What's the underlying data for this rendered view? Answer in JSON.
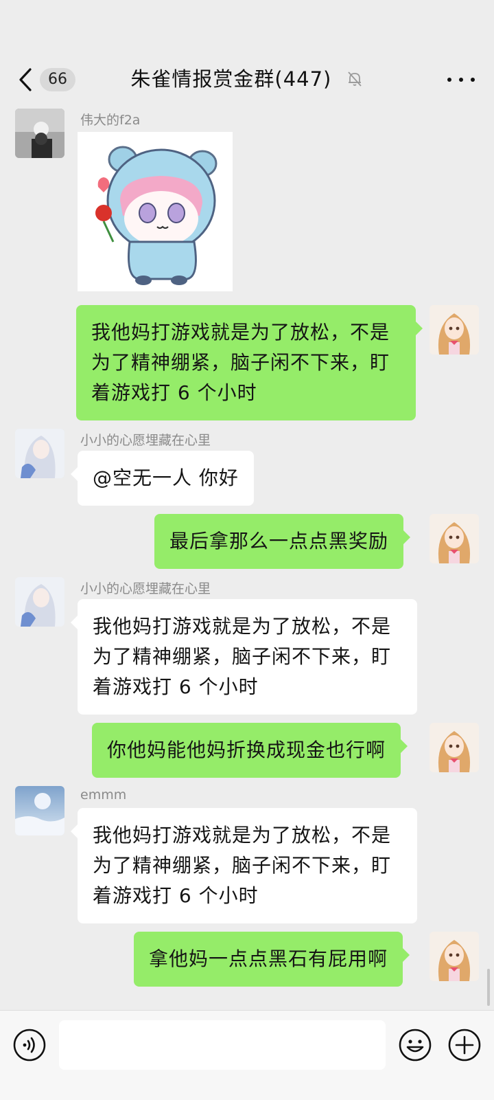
{
  "header": {
    "back_count": "66",
    "title": "朱雀情报赏金群(447)",
    "icons": {
      "back": "chevron-left-icon",
      "mute": "bell-off-icon",
      "more": "more-dots-icon"
    }
  },
  "messages": [
    {
      "side": "left",
      "sender": "伟大的f2a",
      "type": "sticker"
    },
    {
      "side": "right",
      "text": "我他妈打游戏就是为了放松，不是为了精神绷紧，脑子闲不下来，盯着游戏打 6 个小时"
    },
    {
      "side": "left",
      "sender": "小小的心愿埋藏在心里",
      "text": "@空无一人  你好"
    },
    {
      "side": "right",
      "text": "最后拿那么一点点黑奖励"
    },
    {
      "side": "left",
      "sender": "小小的心愿埋藏在心里",
      "text": "我他妈打游戏就是为了放松，不是为了精神绷紧，脑子闲不下来，盯着游戏打 6 个小时"
    },
    {
      "side": "right",
      "text": "你他妈能他妈折换成现金也行啊"
    },
    {
      "side": "left",
      "sender": "emmm",
      "text": "我他妈打游戏就是为了放松，不是为了精神绷紧，脑子闲不下来，盯着游戏打 6 个小时"
    },
    {
      "side": "right",
      "text": "拿他妈一点点黑石有屁用啊"
    }
  ],
  "input_bar": {
    "placeholder": "",
    "icons": {
      "voice": "voice-icon",
      "emoji": "emoji-icon",
      "plus": "plus-icon"
    }
  },
  "colors": {
    "background": "#ededed",
    "self_bubble": "#95ec69",
    "other_bubble": "#ffffff"
  }
}
